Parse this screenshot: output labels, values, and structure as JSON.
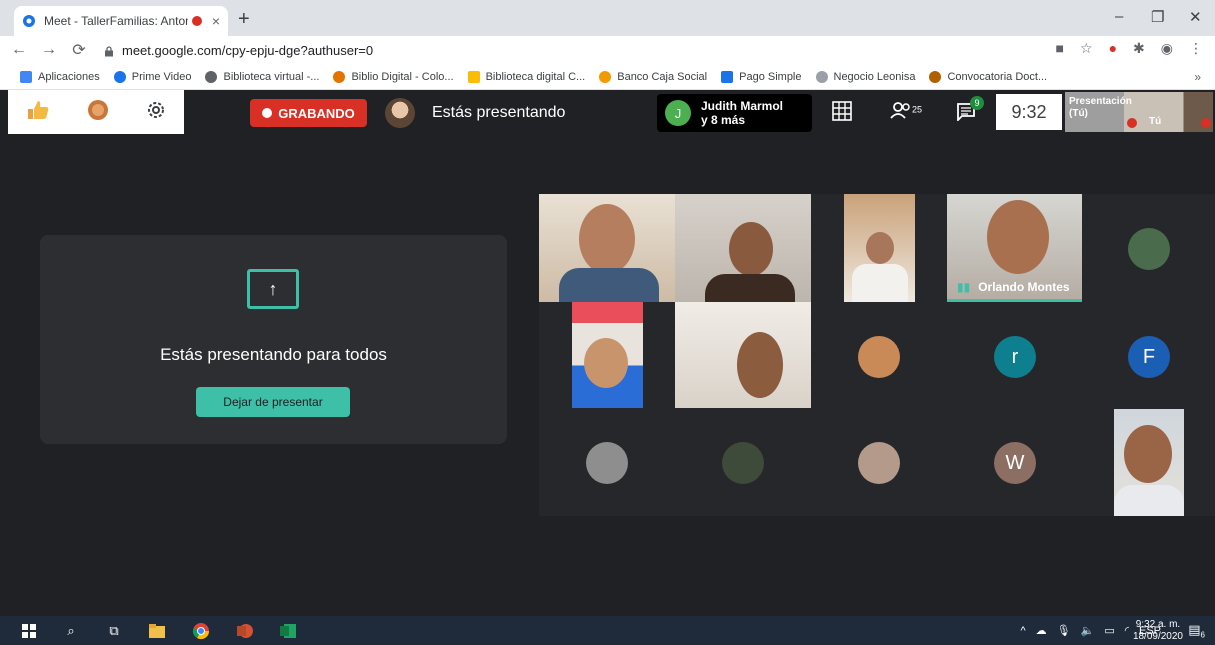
{
  "browser": {
    "tab_title": "Meet - TallerFamilias: Antonio",
    "tab_close": "×",
    "new_tab": "+",
    "url": "meet.google.com/cpy-epju-dge?authuser=0",
    "bookmarks": [
      {
        "label": "Aplicaciones",
        "color": "#4285f4"
      },
      {
        "label": "Prime Video",
        "color": "#1a73e8"
      },
      {
        "label": "Biblioteca virtual -...",
        "color": "#5f6368"
      },
      {
        "label": "Biblio Digital - Colo...",
        "color": "#e37400"
      },
      {
        "label": "Biblioteca digital C...",
        "color": "#fbbc04"
      },
      {
        "label": "Banco Caja Social",
        "color": "#f29900"
      },
      {
        "label": "Pago Simple",
        "color": "#1a73e8"
      },
      {
        "label": "Negocio Leonisa",
        "color": "#5f6368"
      },
      {
        "label": "Convocatoria Doct...",
        "color": "#b06000"
      }
    ],
    "bookmarks_more": "»",
    "window_minimize": "–",
    "window_restore": "❐",
    "window_close": "✕"
  },
  "meet": {
    "recording_label": "GRABANDO",
    "presenting_label": "Estás presentando",
    "active_speaker": {
      "initial": "J",
      "name": "Judith Marmol",
      "others": "y 8 más"
    },
    "participants_count": "25",
    "chat_badge": "9",
    "clock": "9:32",
    "self_tile": {
      "label_line1": "Presentación",
      "label_line2": "(Tú)",
      "you_label": "Tú"
    },
    "present_card": {
      "message": "Estás presentando para todos",
      "stop_button": "Dejar de presentar"
    },
    "tiles": [
      {
        "name": "Orlando Montes"
      },
      {
        "initial": "r",
        "color": "#0e7f8e"
      },
      {
        "initial": "F",
        "color": "#1a5fb4"
      },
      {
        "initial": "W",
        "color": "#8d6e63"
      }
    ]
  },
  "taskbar": {
    "tray_lang": "ESP",
    "time": "9:32 a. m.",
    "date": "18/09/2020",
    "notification_count": "6"
  }
}
